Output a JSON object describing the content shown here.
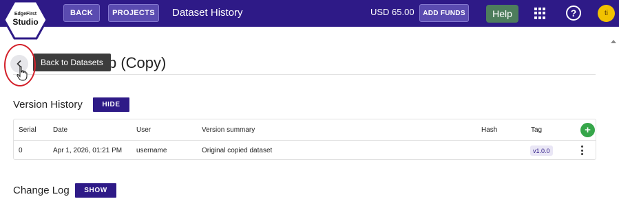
{
  "app": {
    "logo_line1": "EdgeFirst",
    "logo_line2": "Studio"
  },
  "header": {
    "back_label": "BACK",
    "projects_label": "PROJECTS",
    "title": "Dataset History",
    "balance": "USD 65.00",
    "add_funds_label": "ADD FUNDS",
    "help_label": "Help",
    "avatar_initial": "ti"
  },
  "page": {
    "tooltip": "Back to Datasets",
    "heading_visible": "p (Copy)"
  },
  "version_history": {
    "label": "Version History",
    "toggle_label": "HIDE",
    "columns": [
      "Serial",
      "Date",
      "User",
      "Version summary",
      "Hash",
      "Tag"
    ],
    "rows": [
      {
        "serial": "0",
        "date": "Apr 1, 2026, 01:21 PM",
        "user": "username",
        "summary": "Original copied dataset",
        "hash": "",
        "tag": "v1.0.0"
      }
    ]
  },
  "change_log": {
    "label": "Change Log",
    "toggle_label": "SHOW"
  },
  "colors": {
    "brand": "#2e1a87",
    "help": "#4d7d5c",
    "add": "#36a64a",
    "avatar": "#f2c200",
    "highlight": "#d3202a"
  }
}
